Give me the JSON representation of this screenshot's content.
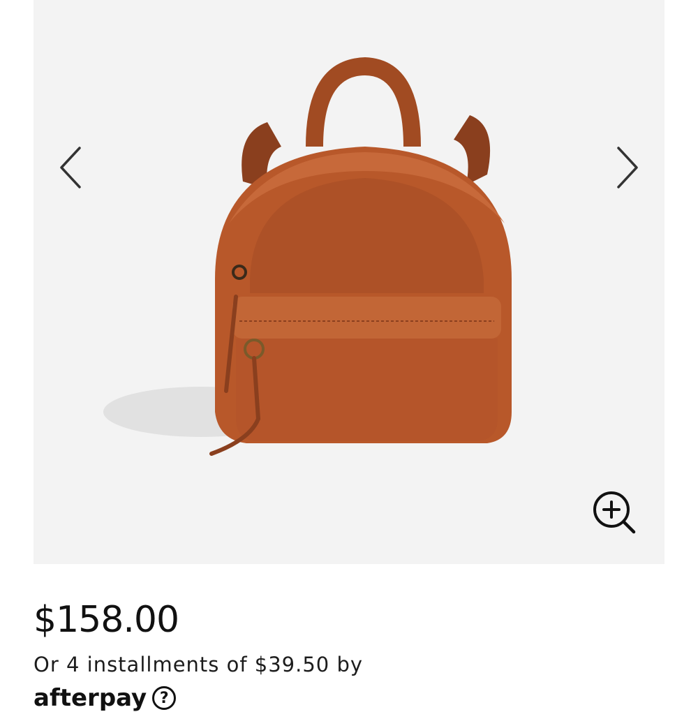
{
  "gallery": {
    "prev_icon": "chevron-left-icon",
    "next_icon": "chevron-right-icon",
    "zoom_icon": "zoom-in-icon",
    "image_subject": "leather-backpack"
  },
  "product": {
    "price": "$158.00",
    "installments_text": "Or 4 installments of $39.50 by",
    "afterpay_brand": "afterpay",
    "info_glyph": "?"
  },
  "colors": {
    "gallery_bg": "#f3f3f3",
    "leather": "#b8582a",
    "text": "#111111"
  }
}
